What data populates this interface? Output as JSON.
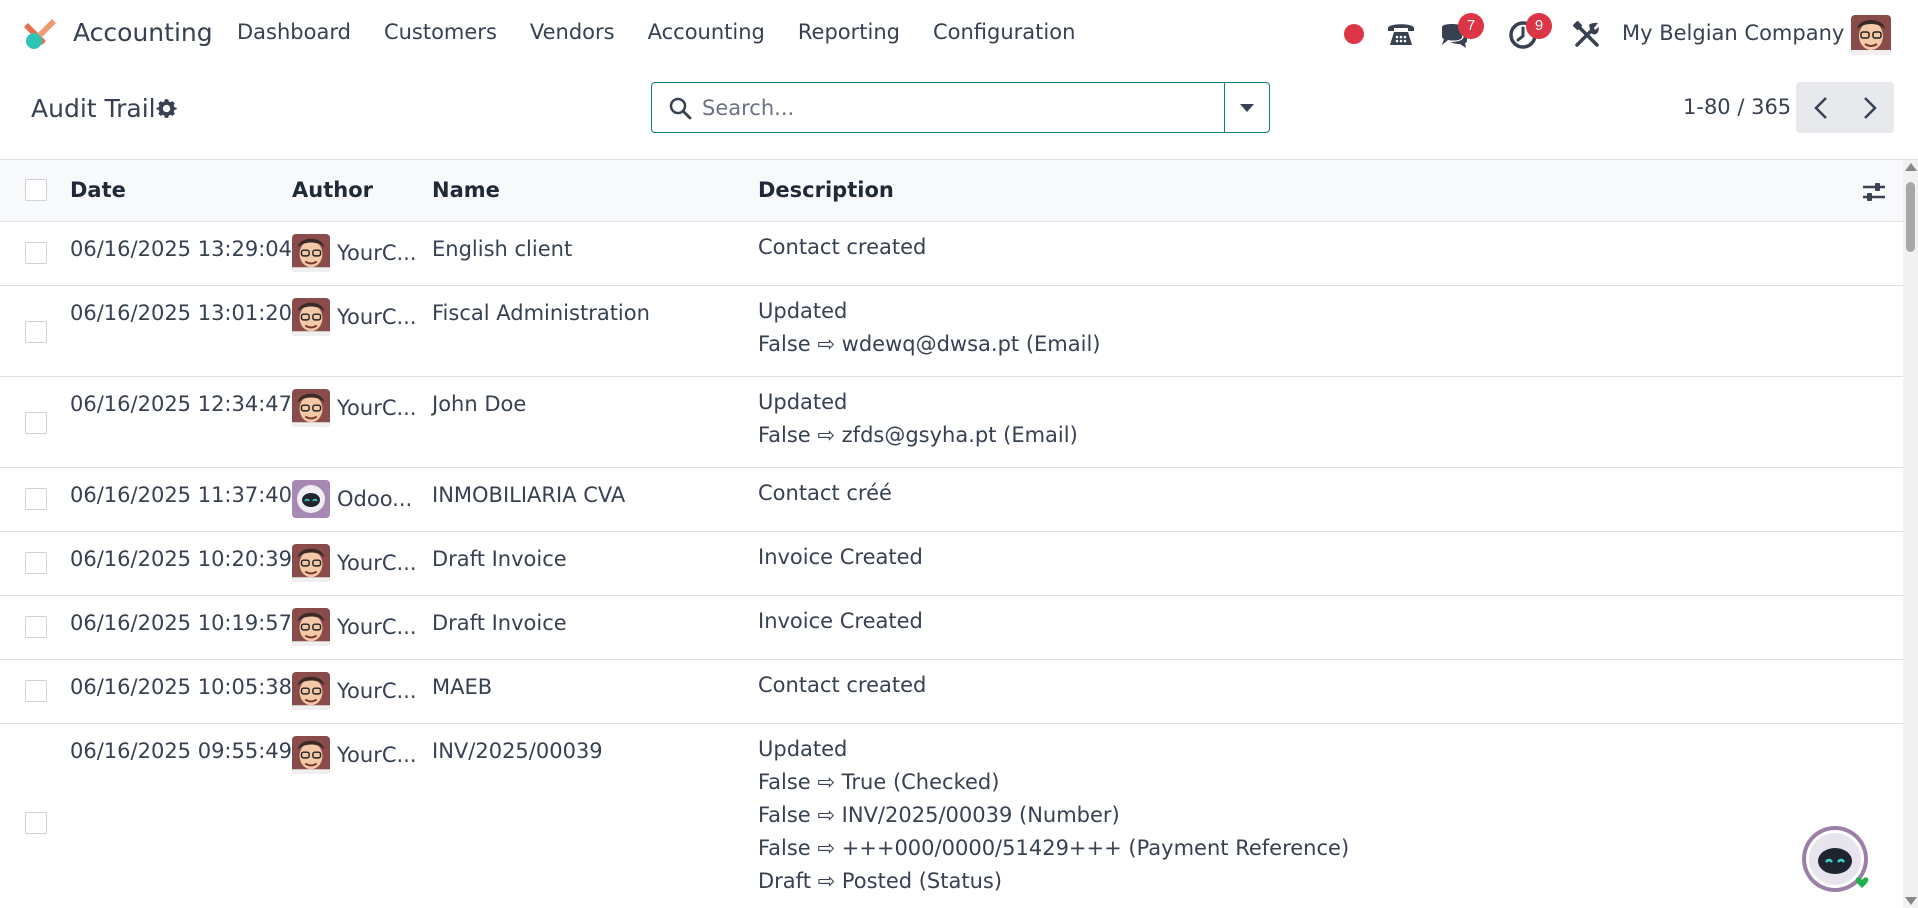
{
  "navbar": {
    "app_name": "Accounting",
    "menu": [
      "Dashboard",
      "Customers",
      "Vendors",
      "Accounting",
      "Reporting",
      "Configuration"
    ],
    "messages_count": "7",
    "activities_count": "9",
    "company": "My Belgian Company",
    "icons": [
      "app-logo-icon",
      "record-dot-icon",
      "phone-icon",
      "chat-icon",
      "clock-icon",
      "tools-icon",
      "user-avatar"
    ]
  },
  "control_panel": {
    "title": "Audit Trail",
    "search_placeholder": "Search...",
    "pager": "1-80 / 365"
  },
  "table": {
    "columns": {
      "date": "Date",
      "author": "Author",
      "name": "Name",
      "description": "Description"
    },
    "rows": [
      {
        "date": "06/16/2025 13:29:04",
        "author": "YourC...",
        "author_type": "user",
        "name": "English client",
        "desc": [
          "Contact created"
        ]
      },
      {
        "date": "06/16/2025 13:01:20",
        "author": "YourC...",
        "author_type": "user",
        "name": "Fiscal Administration",
        "desc": [
          "Updated",
          "False ⇨ wdewq@dwsa.pt (Email)"
        ]
      },
      {
        "date": "06/16/2025 12:34:47",
        "author": "YourC...",
        "author_type": "user",
        "name": "John Doe",
        "desc": [
          "Updated",
          "False ⇨ zfds@gsyha.pt (Email)"
        ]
      },
      {
        "date": "06/16/2025 11:37:40",
        "author": "Odoo...",
        "author_type": "bot",
        "name": "INMOBILIARIA CVA",
        "desc": [
          "Contact créé"
        ]
      },
      {
        "date": "06/16/2025 10:20:39",
        "author": "YourC...",
        "author_type": "user",
        "name": "Draft Invoice",
        "desc": [
          "Invoice Created"
        ]
      },
      {
        "date": "06/16/2025 10:19:57",
        "author": "YourC...",
        "author_type": "user",
        "name": "Draft Invoice",
        "desc": [
          "Invoice Created"
        ]
      },
      {
        "date": "06/16/2025 10:05:38",
        "author": "YourC...",
        "author_type": "user",
        "name": "MAEB",
        "desc": [
          "Contact created"
        ]
      },
      {
        "date": "06/16/2025 09:55:49",
        "author": "YourC...",
        "author_type": "user",
        "name": "INV/2025/00039",
        "desc": [
          "Updated",
          "False ⇨ True (Checked)",
          "False ⇨ INV/2025/00039 (Number)",
          "False ⇨ +++000/0000/51429+++ (Payment Reference)",
          "Draft ⇨ Posted (Status)"
        ]
      }
    ]
  },
  "colors": {
    "accent": "#0e7c86",
    "badge": "#dc3545",
    "header_bg": "#f8f9fa",
    "logo_orange": "#e46f4c",
    "logo_teal": "#2ec4b6"
  }
}
